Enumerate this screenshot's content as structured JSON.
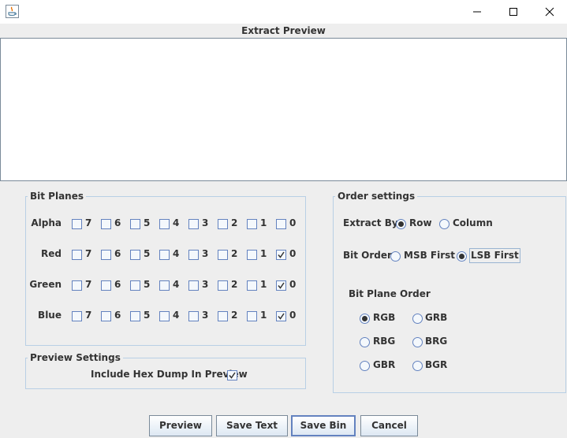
{
  "window": {
    "app_icon": "java-icon",
    "controls": [
      "minimize-icon",
      "maximize-icon",
      "close-icon"
    ]
  },
  "preview": {
    "title": "Extract Preview",
    "content": ""
  },
  "bit_planes": {
    "legend": "Bit Planes",
    "bits": [
      "7",
      "6",
      "5",
      "4",
      "3",
      "2",
      "1",
      "0"
    ],
    "rows": [
      {
        "label": "Alpha",
        "checked": [
          false,
          false,
          false,
          false,
          false,
          false,
          false,
          false
        ]
      },
      {
        "label": "Red",
        "checked": [
          false,
          false,
          false,
          false,
          false,
          false,
          false,
          true
        ]
      },
      {
        "label": "Green",
        "checked": [
          false,
          false,
          false,
          false,
          false,
          false,
          false,
          true
        ]
      },
      {
        "label": "Blue",
        "checked": [
          false,
          false,
          false,
          false,
          false,
          false,
          false,
          true
        ]
      }
    ]
  },
  "preview_settings": {
    "legend": "Preview Settings",
    "hex_dump_label": "Include Hex Dump In Preview",
    "hex_dump_checked": true
  },
  "order_settings": {
    "legend": "Order settings",
    "extract_by_label": "Extract By",
    "extract_by_options": [
      {
        "label": "Row",
        "checked": true
      },
      {
        "label": "Column",
        "checked": false
      }
    ],
    "bit_order_label": "Bit Order",
    "bit_order_options": [
      {
        "label": "MSB First",
        "checked": false
      },
      {
        "label": "LSB First",
        "checked": true
      }
    ],
    "bit_plane_order_label": "Bit Plane Order",
    "bit_plane_order_options": [
      {
        "label": "RGB",
        "checked": true
      },
      {
        "label": "GRB",
        "checked": false
      },
      {
        "label": "RBG",
        "checked": false
      },
      {
        "label": "BRG",
        "checked": false
      },
      {
        "label": "GBR",
        "checked": false
      },
      {
        "label": "BGR",
        "checked": false
      }
    ]
  },
  "buttons": {
    "preview": "Preview",
    "save_text": "Save Text",
    "save_bin": "Save Bin",
    "cancel": "Cancel"
  },
  "colors": {
    "background": "#eeeeee",
    "group_border": "#b8cfe5",
    "control_border": "#6382bf",
    "text": "#333333"
  }
}
